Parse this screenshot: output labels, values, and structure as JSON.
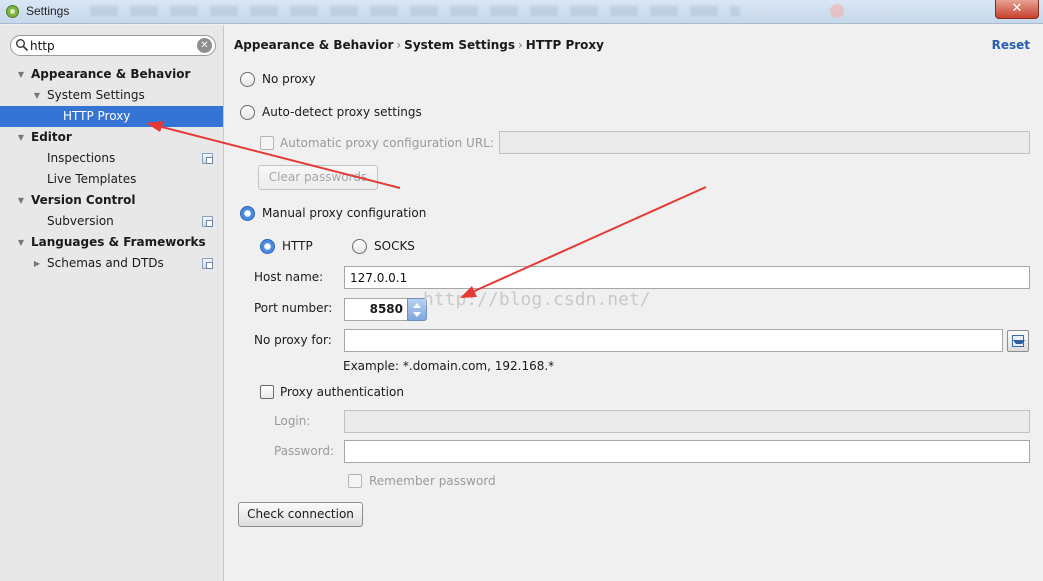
{
  "window": {
    "title": "Settings",
    "close_label": "✕"
  },
  "search": {
    "value": "http"
  },
  "tree": [
    {
      "label": "Appearance & Behavior",
      "level": 0,
      "expanded": true
    },
    {
      "label": "System Settings",
      "level": 1,
      "expanded": true
    },
    {
      "label": "HTTP Proxy",
      "level": 2,
      "selected": true
    },
    {
      "label": "Editor",
      "level": 0,
      "expanded": true
    },
    {
      "label": "Inspections",
      "level": 1,
      "project": true
    },
    {
      "label": "Live Templates",
      "level": 1
    },
    {
      "label": "Version Control",
      "level": 0,
      "expanded": true
    },
    {
      "label": "Subversion",
      "level": 1,
      "project": true
    },
    {
      "label": "Languages & Frameworks",
      "level": 0,
      "expanded": true
    },
    {
      "label": "Schemas and DTDs",
      "level": 1,
      "collapsed": true,
      "project": true
    }
  ],
  "breadcrumb": {
    "part1": "Appearance & Behavior",
    "part2": "System Settings",
    "part3": "HTTP Proxy",
    "separator": "›"
  },
  "reset_label": "Reset",
  "proxy": {
    "no_proxy_label": "No proxy",
    "auto_detect_label": "Auto-detect proxy settings",
    "auto_config_url_label": "Automatic proxy configuration URL:",
    "auto_config_url_value": "",
    "clear_passwords_label": "Clear passwords",
    "manual_label": "Manual proxy configuration",
    "http_label": "HTTP",
    "socks_label": "SOCKS",
    "host_label": "Host name:",
    "host_value": "127.0.0.1",
    "port_label": "Port number:",
    "port_value": "8580",
    "no_proxy_for_label": "No proxy for:",
    "no_proxy_for_value": "",
    "example_text": "Example: *.domain.com, 192.168.*",
    "auth_label": "Proxy authentication",
    "login_label": "Login:",
    "login_value": "",
    "password_label": "Password:",
    "password_value": "",
    "remember_label": "Remember password",
    "check_connection_label": "Check connection",
    "selected_mode": "manual",
    "selected_type": "HTTP"
  },
  "watermark": "http://blog.csdn.net/",
  "colors": {
    "selection": "#3574d5",
    "annotation_arrow": "#e53935",
    "link": "#2a5db0"
  },
  "search_icon": "magnifier-icon",
  "clear_icon": "clear-icon"
}
